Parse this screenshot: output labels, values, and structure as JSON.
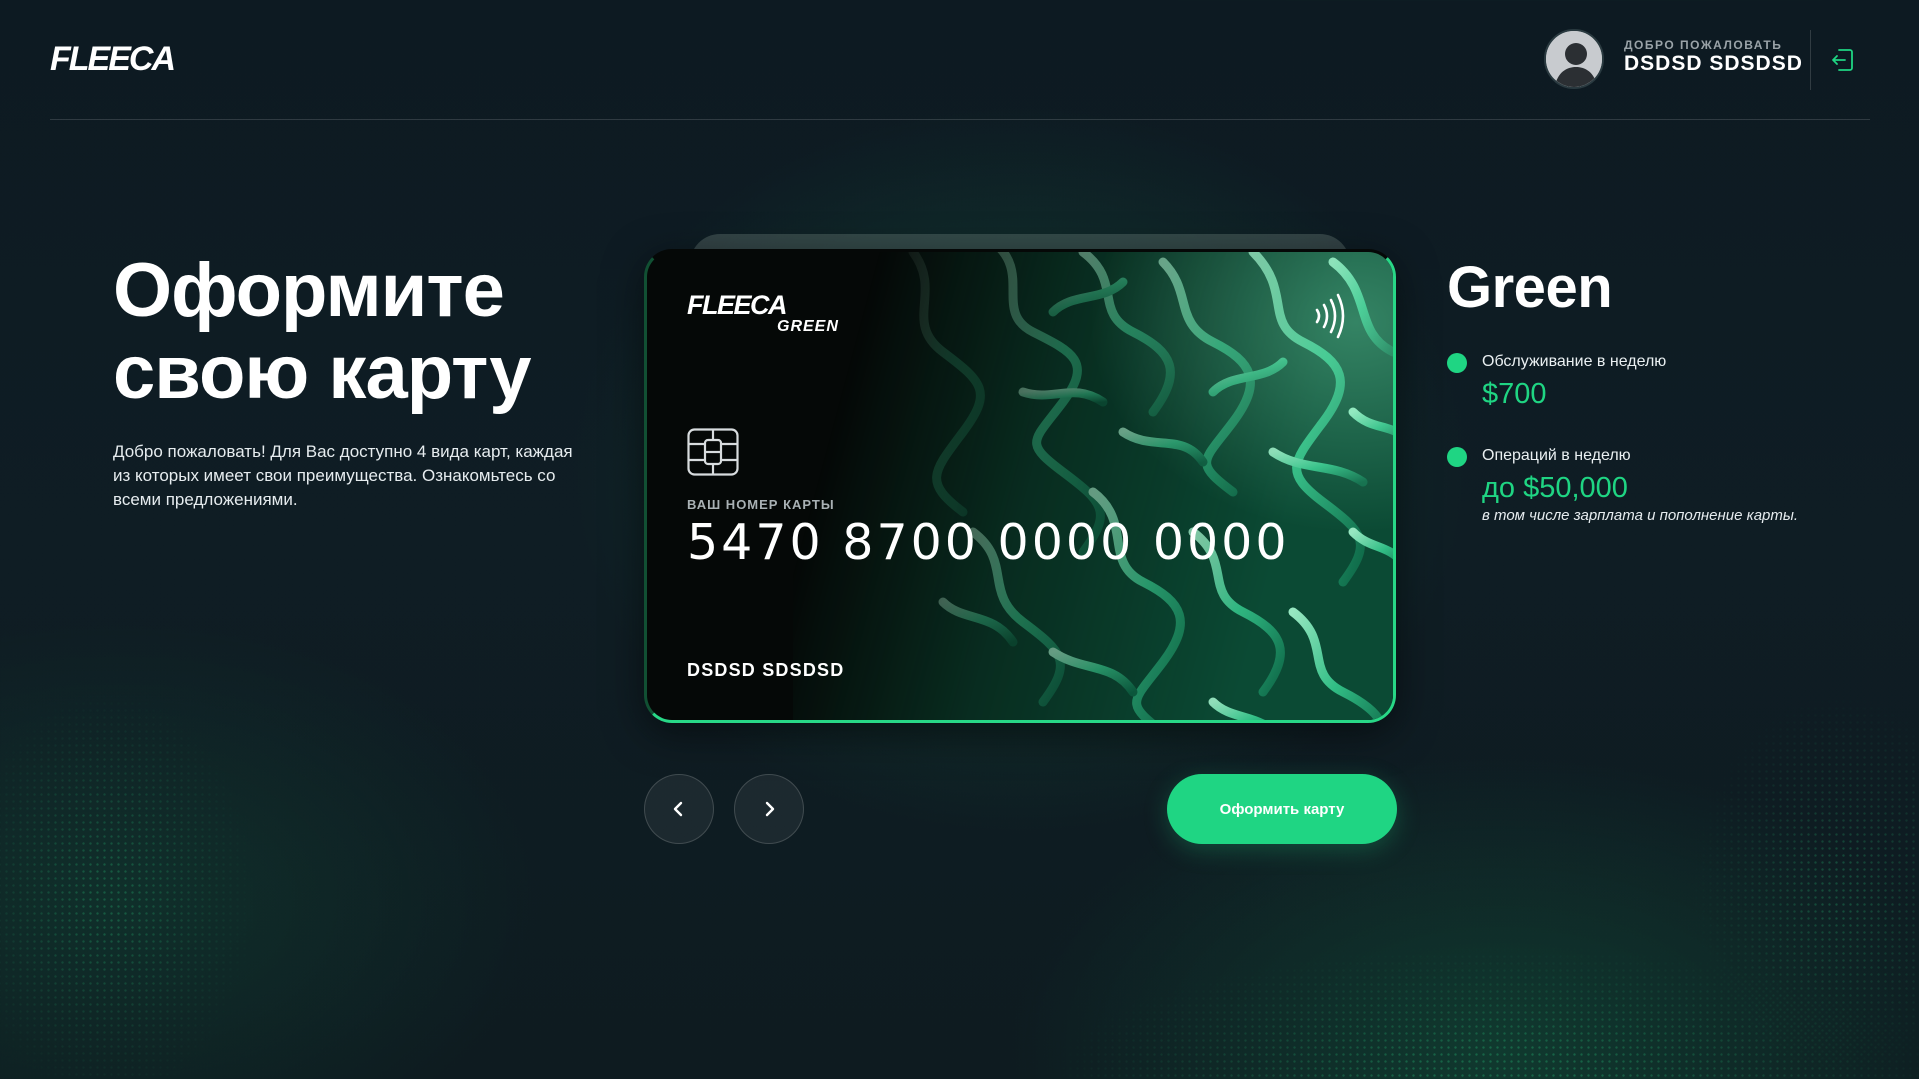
{
  "header": {
    "logo": "FLEECA",
    "welcome_label": "ДОБРО ПОЖАЛОВАТЬ",
    "user_name": "DSDSD SDSDSD"
  },
  "hero": {
    "title_line1": "Оформите",
    "title_line2": "свою карту",
    "description": "Добро пожаловать! Для Вас доступно 4 вида карт, каждая из которых имеет свои преимущества. Ознакомьтесь со всеми предложениями."
  },
  "card": {
    "logo": "FLEECA",
    "tier": "GREEN",
    "number_label": "ВАШ НОМЕР КАРТЫ",
    "number": "5470 8700 0000 0000",
    "holder": "DSDSD SDSDSD"
  },
  "controls": {
    "prev_icon": "chevron-left-icon",
    "next_icon": "chevron-right-icon",
    "cta_label": "Оформить карту"
  },
  "details": {
    "title": "Green",
    "features": [
      {
        "label": "Обслуживание в неделю",
        "value": "$700"
      },
      {
        "label": "Операций в неделю",
        "value": "до $50,000",
        "note": "в том числе зарплата и пополнение карты."
      }
    ]
  },
  "colors": {
    "accent": "#1fd583",
    "background": "#0f1d24",
    "card_black": "#050807"
  }
}
